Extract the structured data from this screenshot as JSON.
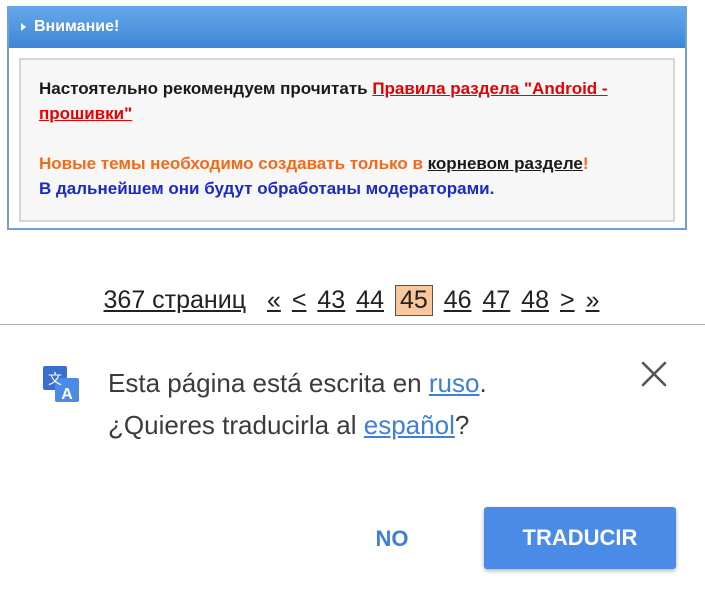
{
  "notice": {
    "title": "Внимание!",
    "line1_text": "Настоятельно рекомендуем прочитать ",
    "line1_link": "Правила раздела \"Android - прошивки\"",
    "line2_text": "Новые темы необходимо создавать только в ",
    "line2_link": "корневом разделе",
    "line2_end": "!",
    "line3_text": "В дальнейшем они будут обработаны модераторами."
  },
  "pagination": {
    "total_pages": "367 страниц",
    "first": "«",
    "prev": "<",
    "pages": [
      "43",
      "44",
      "45",
      "46",
      "47",
      "48"
    ],
    "current": "45",
    "next": ">",
    "last": "»"
  },
  "translate_bar": {
    "icon": "translate-icon",
    "line1_prefix": "Esta página está escrita en ",
    "source_language": "ruso",
    "line1_suffix": ".",
    "line2_prefix": "¿Quieres traducirla al ",
    "target_language": "español",
    "line2_suffix": "?",
    "close_icon": "close-icon",
    "no_label": "NO",
    "translate_label": "TRADUCIR"
  }
}
